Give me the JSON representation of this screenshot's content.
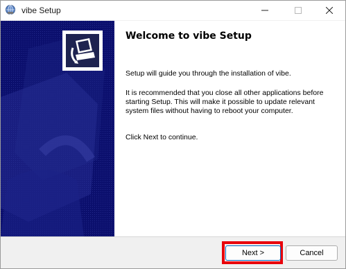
{
  "window": {
    "title": "vibe Setup",
    "controls": {
      "minimize": "—",
      "maximize": "☐",
      "close": "✕"
    }
  },
  "banner": {
    "background_color": "#0b0f6d",
    "logo_icon": "installer-computer-icon"
  },
  "content": {
    "heading": "Welcome to vibe Setup",
    "paragraph1": "Setup will guide you through the installation of vibe.",
    "paragraph2": "It is recommended that you close all other applications before starting Setup. This will make it possible to update relevant system files without having to reboot your computer.",
    "paragraph3": "Click Next to continue."
  },
  "footer": {
    "next_label": "Next >",
    "cancel_label": "Cancel"
  },
  "colors": {
    "highlight": "#e8000b",
    "accent": "#0067c0"
  }
}
